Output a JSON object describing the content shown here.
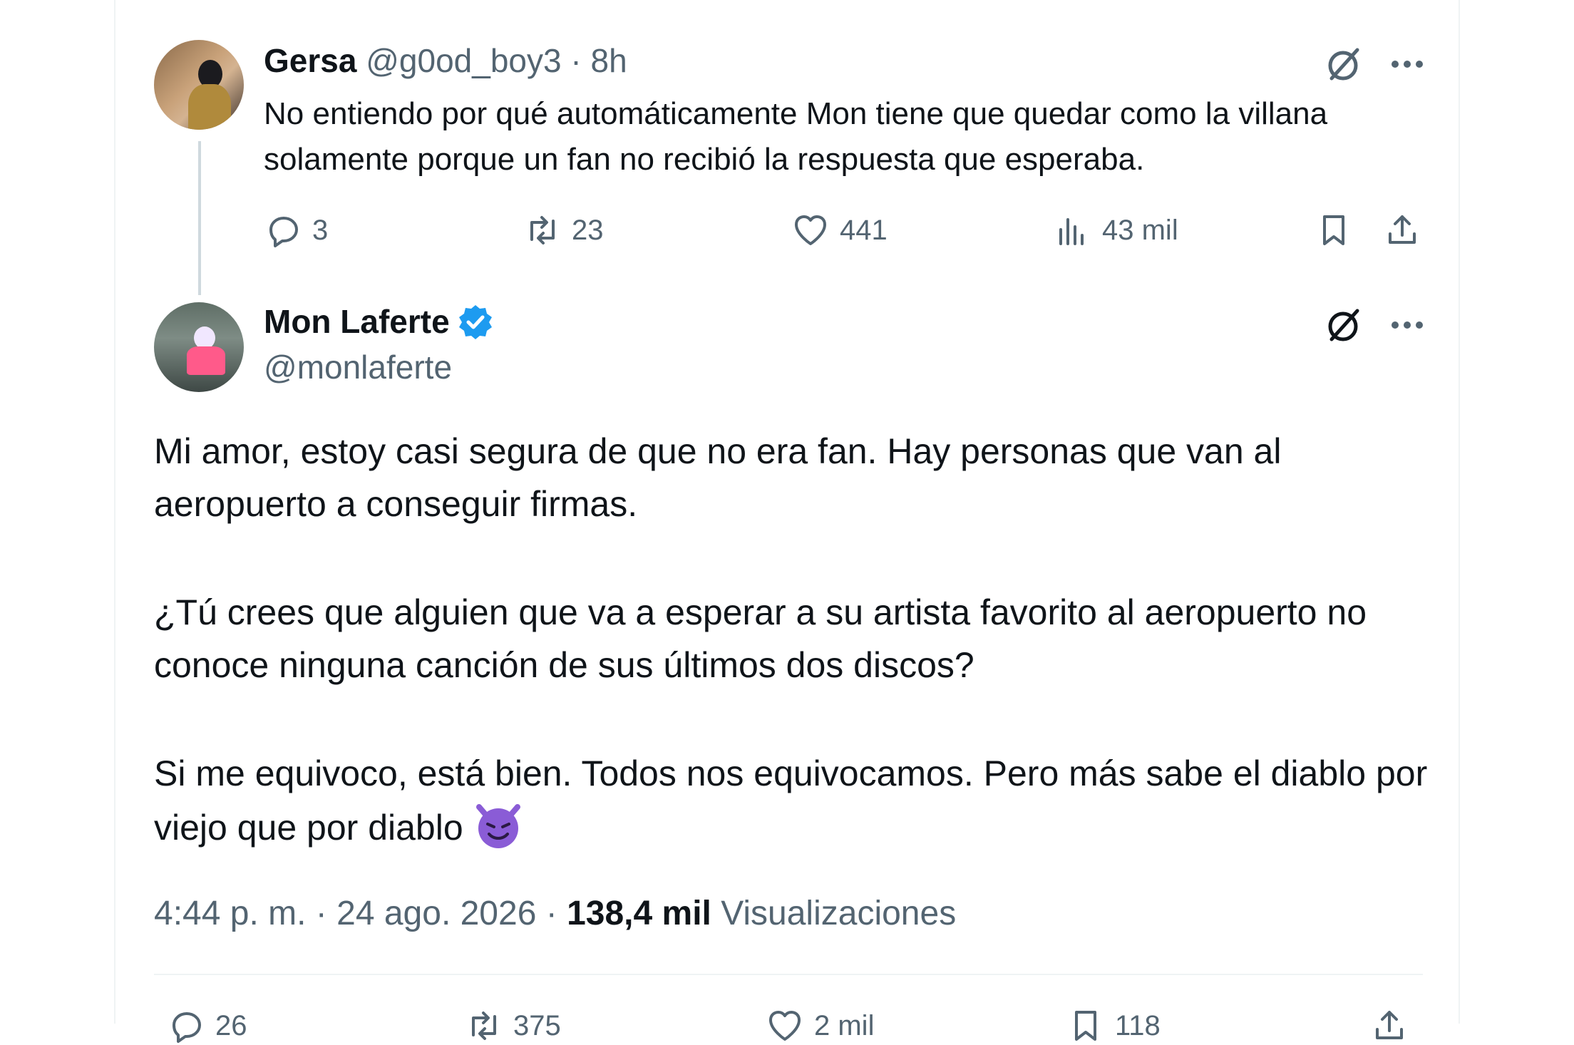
{
  "reply_tweet": {
    "display_name": "Gersa",
    "handle": "@g0od_boy3",
    "separator": "·",
    "time": "8h",
    "text": "No entiendo por qué automáticamente Mon tiene que quedar como la villana solamente porque un fan no recibió la respuesta que esperaba.",
    "replies": "3",
    "reposts": "23",
    "likes": "441",
    "views": "43 mil"
  },
  "main_tweet": {
    "display_name": "Mon Laferte",
    "handle": "@monlaferte",
    "paragraph_1": "Mi amor, estoy casi segura de que no era fan. Hay personas que van al aeropuerto a conseguir firmas.",
    "paragraph_2": "¿Tú crees que alguien que va a esperar a su artista favorito al aeropuerto no conoce ninguna canción de sus últimos dos discos?",
    "paragraph_3": "Si me equivoco, está bien. Todos nos equivocamos. Pero más sabe el diablo por viejo que por diablo",
    "time": "4:44 p. m.",
    "date": "24 ago. 2026",
    "separator": "·",
    "views_count": "138,4 mil",
    "views_label": "Visualizaciones",
    "replies": "26",
    "reposts": "375",
    "likes": "2 mil",
    "bookmarks": "118"
  },
  "colors": {
    "verified": "#1d9bf0",
    "muted": "#536471",
    "text": "#0f1419",
    "emoji": "#8a5cd6"
  },
  "icons": [
    "grok-icon",
    "more-icon",
    "reply-icon",
    "repost-icon",
    "like-icon",
    "views-icon",
    "bookmark-icon",
    "share-icon",
    "verified-badge-icon",
    "smiling-devil-emoji"
  ]
}
